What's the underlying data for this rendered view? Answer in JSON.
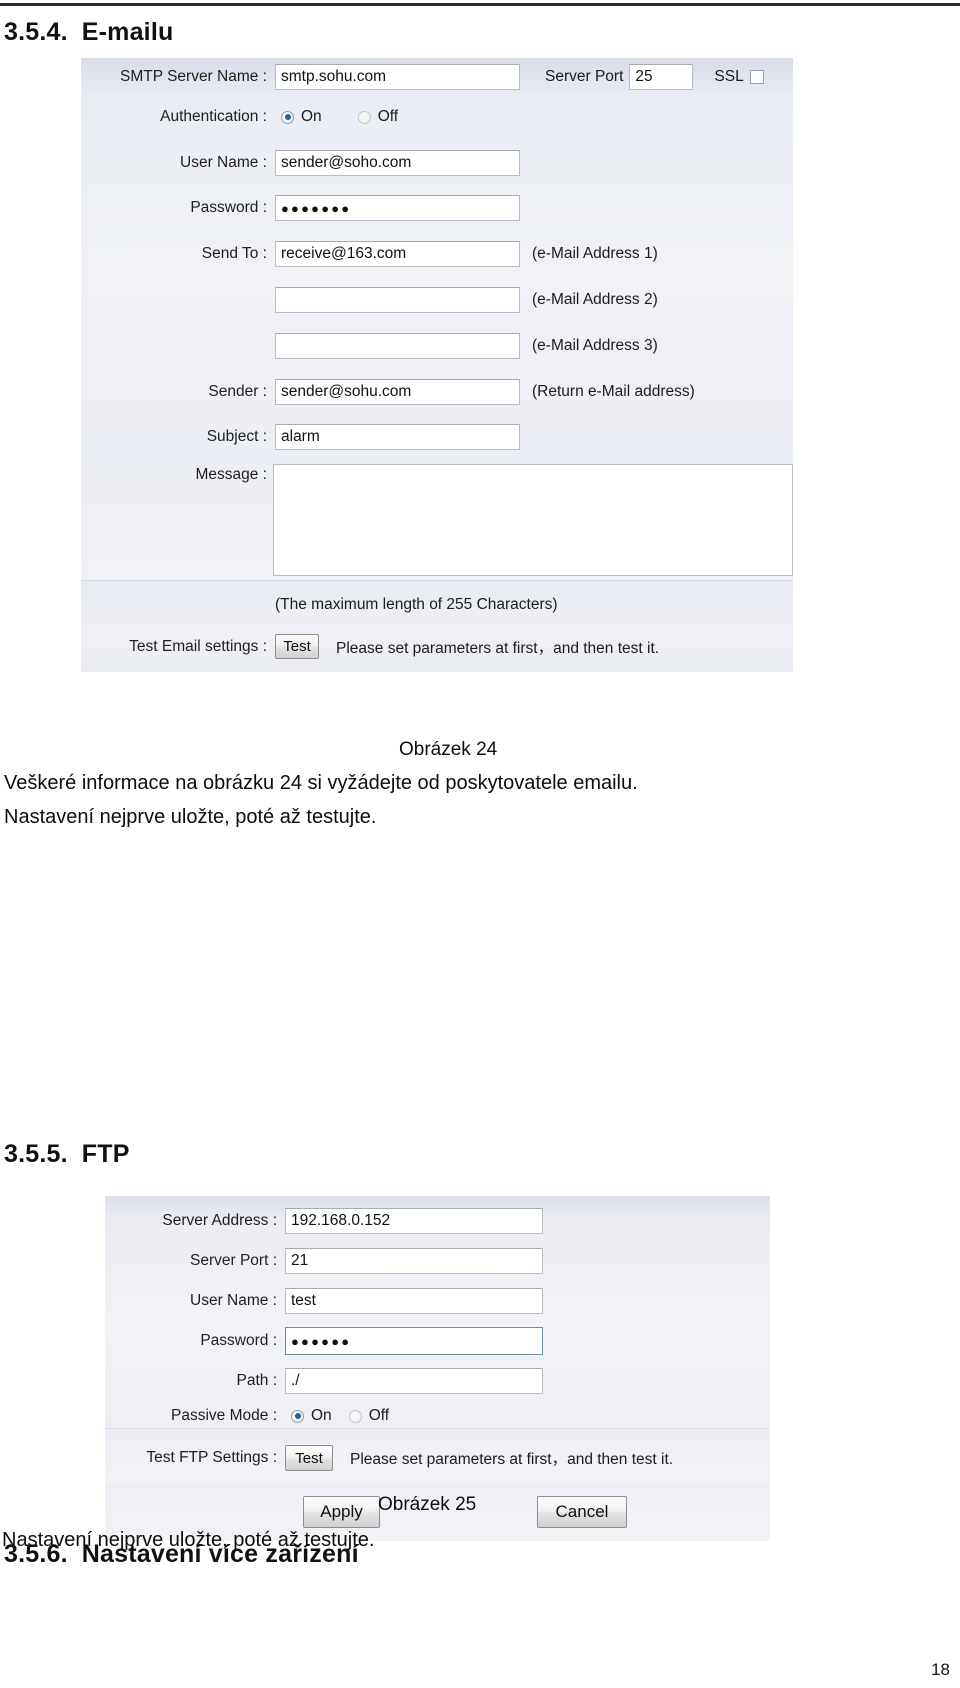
{
  "document": {
    "page_number": "18"
  },
  "sections": {
    "email": {
      "number": "3.5.4.",
      "title": "E-mailu"
    },
    "ftp": {
      "number": "3.5.5.",
      "title": "FTP"
    },
    "multi": {
      "number": "3.5.6.",
      "title": "Nastavení více zařízení"
    }
  },
  "figure24": {
    "caption": "Obrázek 24",
    "smtp_server_name_label": "SMTP Server Name :",
    "smtp_server_name_value": "smtp.sohu.com",
    "server_port_label": "Server Port",
    "server_port_value": "25",
    "ssl_label": "SSL",
    "authentication_label": "Authentication :",
    "auth_on_label": "On",
    "auth_off_label": "Off",
    "user_name_label": "User Name :",
    "user_name_value": "sender@soho.com",
    "password_label": "Password :",
    "password_value": "●●●●●●●",
    "send_to_label": "Send To :",
    "send_to_value": "receive@163.com",
    "email_address_1_note": "(e-Mail Address 1)",
    "email_address_2_value": "",
    "email_address_2_note": "(e-Mail Address 2)",
    "email_address_3_value": "",
    "email_address_3_note": "(e-Mail Address 3)",
    "sender_label": "Sender :",
    "sender_value": "sender@sohu.com",
    "sender_note": "(Return e-Mail address)",
    "subject_label": "Subject :",
    "subject_value": "alarm",
    "message_label": "Message :",
    "message_value": "",
    "max_length_note": "(The maximum length of 255 Characters)",
    "test_email_label": "Test Email settings :",
    "test_button_label": "Test",
    "test_hint": "Please set parameters at first，and then test it."
  },
  "figure25": {
    "caption": "Obrázek 25",
    "server_address_label": "Server Address :",
    "server_address_value": "192.168.0.152",
    "server_port_label": "Server Port :",
    "server_port_value": "21",
    "user_name_label": "User Name :",
    "user_name_value": "test",
    "password_label": "Password :",
    "password_value": "●●●●●●",
    "path_label": "Path :",
    "path_value": "./",
    "passive_mode_label": "Passive Mode :",
    "passive_on_label": "On",
    "passive_off_label": "Off",
    "test_ftp_label": "Test FTP Settings :",
    "test_button_label": "Test",
    "test_hint": "Please set parameters at first，and then test it.",
    "apply_label": "Apply",
    "cancel_label": "Cancel"
  },
  "body_text": {
    "para_24_line1": "Veškeré informace na obrázku 24 si vyžádejte od poskytovatele emailu.",
    "para_24_line2": "Nastavení nejprve uložte, poté až testujte.",
    "para_25_line1": "Nastavení nejprve uložte, poté až testujte."
  },
  "colors": {
    "radio_selected": "#1b63a5",
    "panel_base": "#eef0f5",
    "field_border": "#b9bcc4",
    "focus_border": "#6f92a6"
  }
}
